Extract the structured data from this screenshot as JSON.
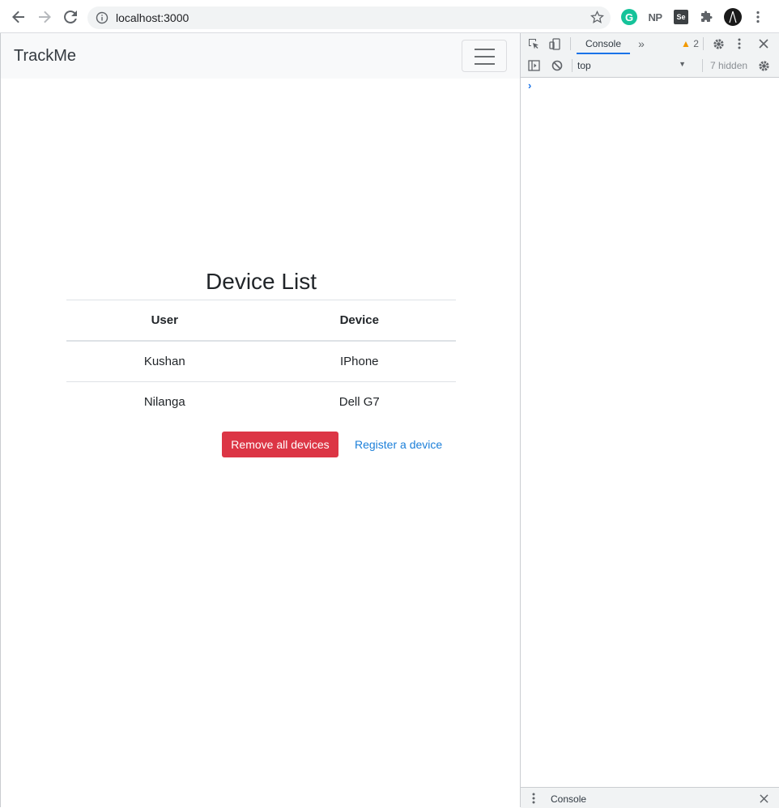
{
  "browser": {
    "url": "localhost:3000",
    "extensions": {
      "grammarly": "G",
      "np": "NP",
      "se": "Se"
    }
  },
  "navbar": {
    "brand": "TrackMe"
  },
  "main": {
    "title": "Device List",
    "table": {
      "headers": [
        "User",
        "Device"
      ],
      "rows": [
        [
          "Kushan",
          "IPhone"
        ],
        [
          "Nilanga",
          "Dell G7"
        ]
      ]
    },
    "actions": {
      "remove_label": "Remove all devices",
      "register_label": "Register a device"
    }
  },
  "devtools": {
    "tab_console": "Console",
    "warning_count": "2",
    "context": "top",
    "hidden_count": "7 hidden",
    "prompt": "›",
    "drawer_label": "Console"
  },
  "colors": {
    "danger": "#dc3545",
    "link": "#1b7fd9",
    "devtools_accent": "#1a73e8"
  }
}
